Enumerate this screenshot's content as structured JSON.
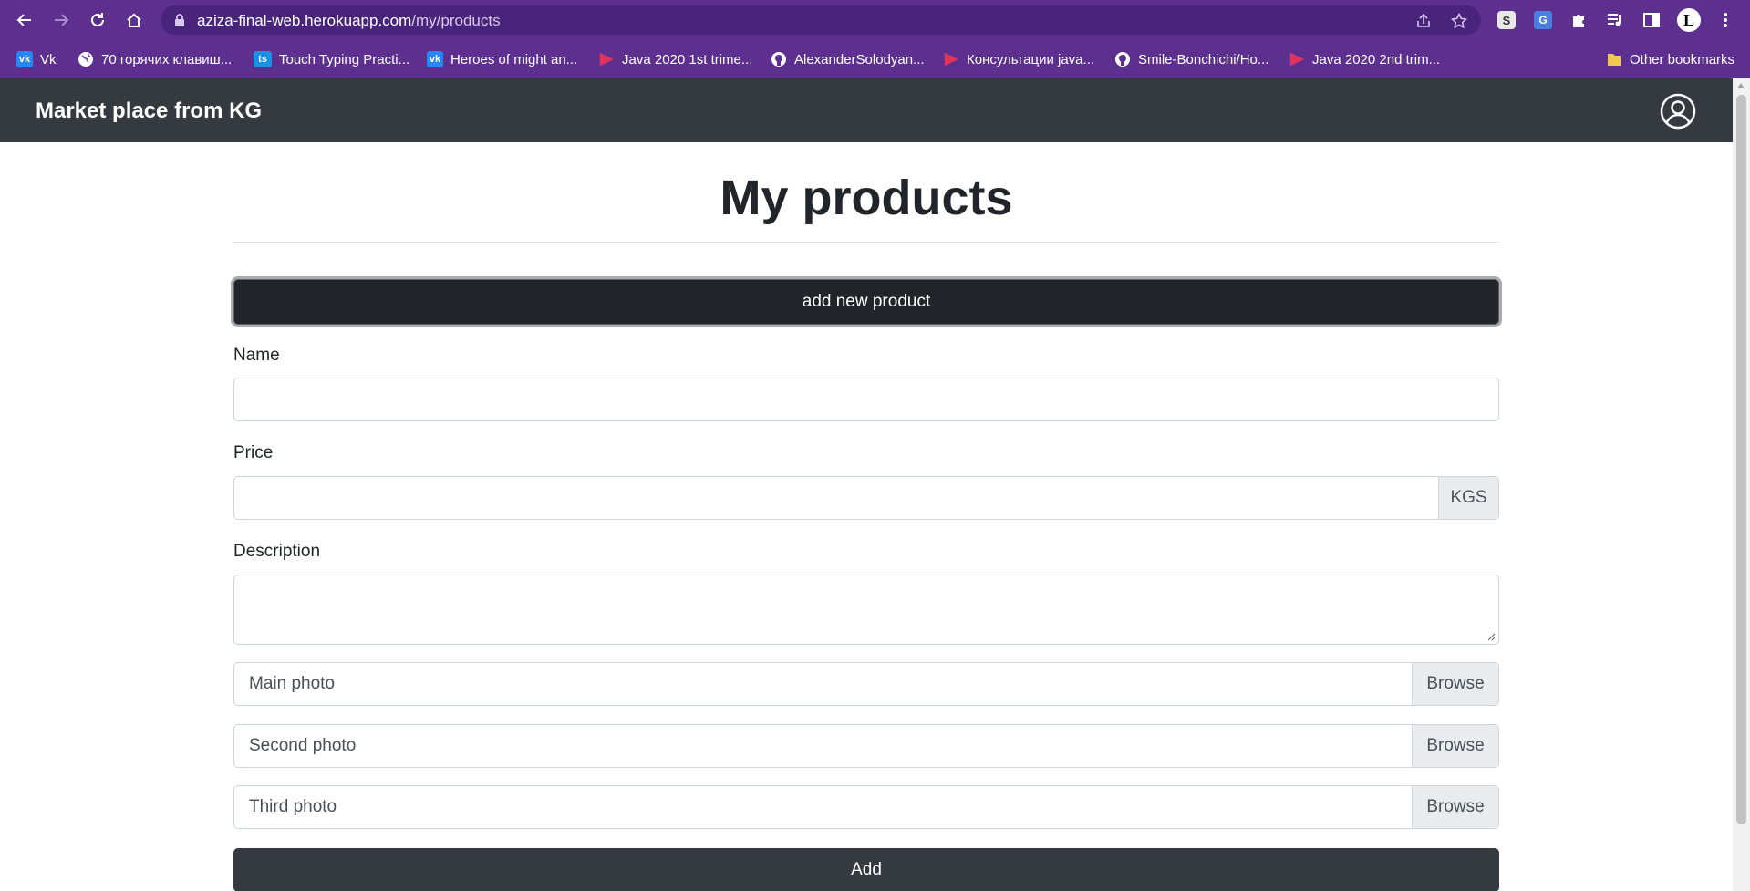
{
  "browser": {
    "url_host": "aziza-final-web.herokuapp.com",
    "url_path": "/my/products",
    "bookmarks": [
      {
        "label": "Vk",
        "icon": "vk-icon"
      },
      {
        "label": "70 горячих клавиш...",
        "icon": "globe-icon"
      },
      {
        "label": "Touch Typing Practi...",
        "icon": "ts-icon"
      },
      {
        "label": "Heroes of might an...",
        "icon": "vk-icon"
      },
      {
        "label": "Java 2020 1st trime...",
        "icon": "play-icon"
      },
      {
        "label": "AlexanderSolodyan...",
        "icon": "github-icon"
      },
      {
        "label": "Консультации java...",
        "icon": "play-icon"
      },
      {
        "label": "Smile-Bonchichi/Ho...",
        "icon": "github-icon"
      },
      {
        "label": "Java 2020 2nd trim...",
        "icon": "play-icon"
      }
    ],
    "other_bookmarks": "Other bookmarks",
    "ts_icon_text": "ts",
    "vk_icon_text": "vk",
    "profile_initial": "L"
  },
  "navbar": {
    "brand": "Market place from KG"
  },
  "main": {
    "title": "My products",
    "add_new_label": "add new product",
    "form": {
      "name_label": "Name",
      "price_label": "Price",
      "currency": "KGS",
      "description_label": "Description",
      "files": [
        {
          "label": "Main photo",
          "button": "Browse"
        },
        {
          "label": "Second photo",
          "button": "Browse"
        },
        {
          "label": "Third photo",
          "button": "Browse"
        }
      ],
      "submit_label": "Add"
    }
  },
  "colors": {
    "browser_frame": "#5d3090",
    "navbar_bg": "#343a40",
    "button_dark": "#212529"
  }
}
